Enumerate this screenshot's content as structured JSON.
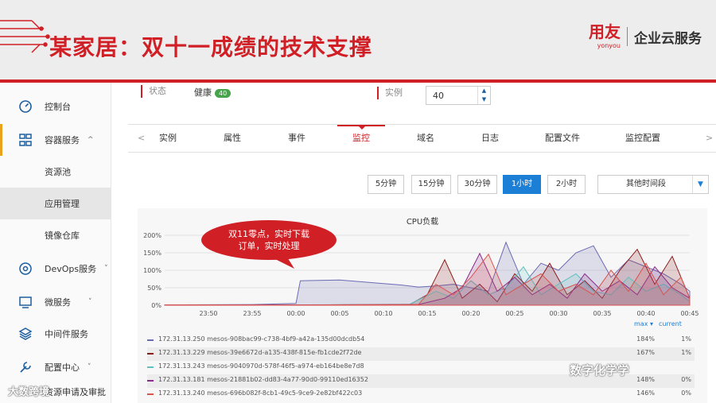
{
  "slide": {
    "title": "某家居：双十一成绩的技术支撑",
    "brand_logo": "用友",
    "brand_logo_sub": "yonyou",
    "brand_text": "企业云服务"
  },
  "sidebar": {
    "items": [
      {
        "label": "控制台",
        "icon": "dashboard-icon"
      },
      {
        "label": "容器服务",
        "icon": "container-icon",
        "caret": "^"
      },
      {
        "label": "资源池"
      },
      {
        "label": "应用管理"
      },
      {
        "label": "镜像仓库"
      },
      {
        "label": "DevOps服务",
        "icon": "devops-icon",
        "caret": "˅"
      },
      {
        "label": "微服务",
        "icon": "monitor-icon",
        "caret": "˅"
      },
      {
        "label": "中间件服务",
        "icon": "layers-icon"
      },
      {
        "label": "配置中心",
        "icon": "wrench-icon",
        "caret": "˅"
      },
      {
        "label": "资源申请及审批"
      }
    ]
  },
  "info": {
    "status_label": "状态",
    "status_value": "健康",
    "status_badge": "40",
    "instance_label": "实例",
    "instance_value": "40"
  },
  "tabs": {
    "items": [
      "实例",
      "属性",
      "事件",
      "监控",
      "域名",
      "日志",
      "配置文件",
      "监控配置"
    ],
    "active": "监控",
    "prev": "<",
    "next": ">"
  },
  "time_range": {
    "buttons": [
      "5分钟",
      "15分钟",
      "30分钟",
      "1小时",
      "2小时"
    ],
    "active": "1小时",
    "select_value": "其他时间段"
  },
  "callout": {
    "line1": "双11零点，实时下载",
    "line2": "订单，实时处理",
    "color": "#d11f26"
  },
  "legend": {
    "max_header": "max ▾",
    "current_header": "current",
    "rows": [
      {
        "name": "172.31.13.250 mesos-908bac99-c738-4bf9-a42a-135d00dcdb54",
        "max": "184%",
        "current": "1%",
        "color": "#6b6bb3"
      },
      {
        "name": "172.31.13.229 mesos-39e6672d-a135-438f-815e-fb1cde2f72de",
        "max": "167%",
        "current": "1%",
        "color": "#8b1a1a"
      },
      {
        "name": "172.31.13.243 mesos-9040970d-578f-46f5-a974-eb164be8e7d8",
        "max": "",
        "current": "",
        "color": "#5fc0c0"
      },
      {
        "name": "172.31.13.181 mesos-21881b02-dd83-4a77-90d0-99110ed16352",
        "max": "148%",
        "current": "0%",
        "color": "#8a2a8a"
      },
      {
        "name": "172.31.13.240 mesos-696b082f-8cb1-49c5-9ce9-2e82bf422c03",
        "max": "146%",
        "current": "0%",
        "color": "#d9534f"
      }
    ]
  },
  "watermarks": {
    "left": "大数跨境",
    "right": "数字化学学"
  },
  "chart_data": {
    "type": "area",
    "title": "CPU负载",
    "x_ticks": [
      "23:50",
      "23:55",
      "00:00",
      "00:05",
      "00:10",
      "00:15",
      "00:20",
      "00:25",
      "00:30",
      "00:35",
      "00:40",
      "00:45"
    ],
    "y_ticks": [
      "0%",
      "50%",
      "100%",
      "150%",
      "200%"
    ],
    "ylim": [
      0,
      200
    ],
    "x_minutes": [
      -15,
      45
    ],
    "series": [
      {
        "name": "172.31.13.250 mesos-908bac99-c738-4bf9-a42a-135d00dcdb54",
        "color": "#6b6bb3",
        "x": [
          -15,
          -5,
          0,
          0.5,
          5,
          10,
          12,
          14,
          16,
          18,
          20,
          22,
          24,
          26,
          28,
          30,
          32,
          34,
          36,
          38,
          40,
          42,
          44,
          45
        ],
        "y": [
          1,
          2,
          5,
          70,
          72,
          62,
          58,
          52,
          55,
          60,
          50,
          40,
          180,
          60,
          120,
          100,
          150,
          170,
          80,
          130,
          110,
          90,
          60,
          40
        ]
      },
      {
        "name": "172.31.13.229 mesos-39e6672d-a135-438f-815e-fb1cde2f72de",
        "color": "#8b1a1a",
        "x": [
          -15,
          0,
          13,
          15,
          17,
          19,
          21,
          23,
          25,
          27,
          29,
          31,
          33,
          35,
          37,
          39,
          41,
          43,
          45
        ],
        "y": [
          1,
          1,
          2,
          30,
          130,
          20,
          60,
          10,
          90,
          40,
          120,
          30,
          70,
          20,
          100,
          160,
          60,
          140,
          20
        ]
      },
      {
        "name": "172.31.13.243 mesos-9040970d-578f-46f5-a974-eb164be8e7d8",
        "color": "#5fc0c0",
        "x": [
          -15,
          0,
          13,
          16,
          18,
          20,
          22,
          24,
          26,
          28,
          30,
          32,
          34,
          36,
          38,
          40,
          42,
          44,
          45
        ],
        "y": [
          1,
          1,
          3,
          40,
          20,
          70,
          30,
          50,
          110,
          30,
          60,
          90,
          40,
          30,
          80,
          40,
          60,
          30,
          10
        ]
      },
      {
        "name": "172.31.13.181 mesos-21881b02-dd83-4a77-90d0-99110ed16352",
        "color": "#8a2a8a",
        "x": [
          -15,
          0,
          14,
          17,
          19,
          21,
          23,
          25,
          27,
          29,
          31,
          33,
          35,
          37,
          39,
          41,
          43,
          45
        ],
        "y": [
          1,
          1,
          2,
          20,
          50,
          148,
          40,
          80,
          30,
          60,
          20,
          90,
          40,
          70,
          30,
          110,
          50,
          20
        ]
      },
      {
        "name": "172.31.13.240 mesos-696b082f-8cb1-49c5-9ce9-2e82bf422c03",
        "color": "#d9534f",
        "x": [
          -15,
          0,
          14,
          16,
          18,
          20,
          22,
          24,
          26,
          28,
          30,
          32,
          34,
          36,
          38,
          40,
          42,
          44,
          45
        ],
        "y": [
          1,
          1,
          2,
          60,
          30,
          80,
          146,
          30,
          60,
          90,
          40,
          60,
          30,
          100,
          40,
          120,
          30,
          80,
          20
        ]
      }
    ]
  }
}
